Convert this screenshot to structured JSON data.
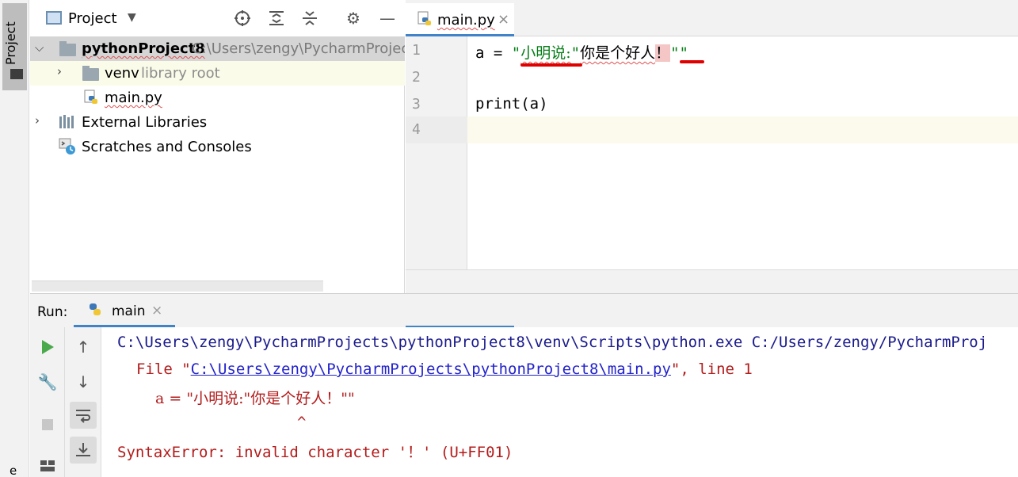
{
  "sidebar": {
    "project_tab_label": "Project",
    "bottom_text": "e"
  },
  "project": {
    "title": "Project",
    "tree": {
      "root_name": "pythonProject8",
      "root_path": "C:\\Users\\zengy\\PycharmProjects\\",
      "venv_name": "venv",
      "venv_hint": "library root",
      "file_name": "main.py",
      "external_libraries": "External Libraries",
      "scratches": "Scratches and Consoles"
    }
  },
  "editor": {
    "tab_label": "main.py",
    "line_numbers": [
      "1",
      "2",
      "3",
      "4"
    ],
    "line1": {
      "prefix": "a = ",
      "q_open": "\"",
      "str1": "小明说:",
      "q_close": "\"",
      "text": "你是个好人",
      "bad_char": "！",
      "tail": "\"\""
    },
    "line3": "print(a)"
  },
  "run": {
    "label": "Run:",
    "tab_label": "main",
    "console": {
      "cmd": "C:\\Users\\zengy\\PycharmProjects\\pythonProject8\\venv\\Scripts\\python.exe C:/Users/zengy/PycharmProj",
      "file_prefix": "File \"",
      "file_link": "C:\\Users\\zengy\\PycharmProjects\\pythonProject8\\main.py",
      "file_suffix": "\", line 1",
      "src_line": "a = \"小明说:\"你是个好人！\"\"",
      "caret": "^",
      "error": "SyntaxError: invalid character '！' (U+FF01)"
    }
  },
  "colors": {
    "accent": "#4083c9",
    "error_red": "#b31b1b",
    "string_green": "#067d17",
    "console_blue": "#1a1a8c"
  }
}
